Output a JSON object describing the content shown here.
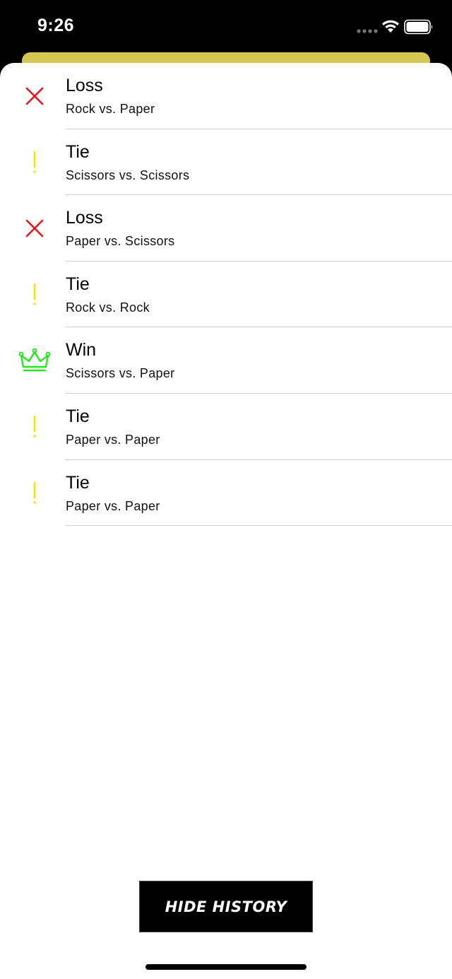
{
  "status_bar": {
    "time": "9:26"
  },
  "history": {
    "rows": [
      {
        "result": "Loss",
        "matchup": "Rock vs. Paper",
        "icon": "x-icon",
        "icon_color": "#e8141d"
      },
      {
        "result": "Tie",
        "matchup": "Scissors vs. Scissors",
        "icon": "exclamation-icon",
        "icon_color": "#f5e400"
      },
      {
        "result": "Loss",
        "matchup": "Paper vs. Scissors",
        "icon": "x-icon",
        "icon_color": "#e8141d"
      },
      {
        "result": "Tie",
        "matchup": "Rock vs. Rock",
        "icon": "exclamation-icon",
        "icon_color": "#f5e400"
      },
      {
        "result": "Win",
        "matchup": "Scissors vs. Paper",
        "icon": "crown-icon",
        "icon_color": "#22e81d"
      },
      {
        "result": "Tie",
        "matchup": "Paper vs. Paper",
        "icon": "exclamation-icon",
        "icon_color": "#f5e400"
      },
      {
        "result": "Tie",
        "matchup": "Paper vs. Paper",
        "icon": "exclamation-icon",
        "icon_color": "#f5e400"
      }
    ]
  },
  "footer": {
    "hide_history_label": "HIDE HISTORY"
  },
  "colors": {
    "accent_sheet": "#d4c64e",
    "loss": "#e8141d",
    "tie": "#f5e400",
    "win": "#22e81d"
  }
}
